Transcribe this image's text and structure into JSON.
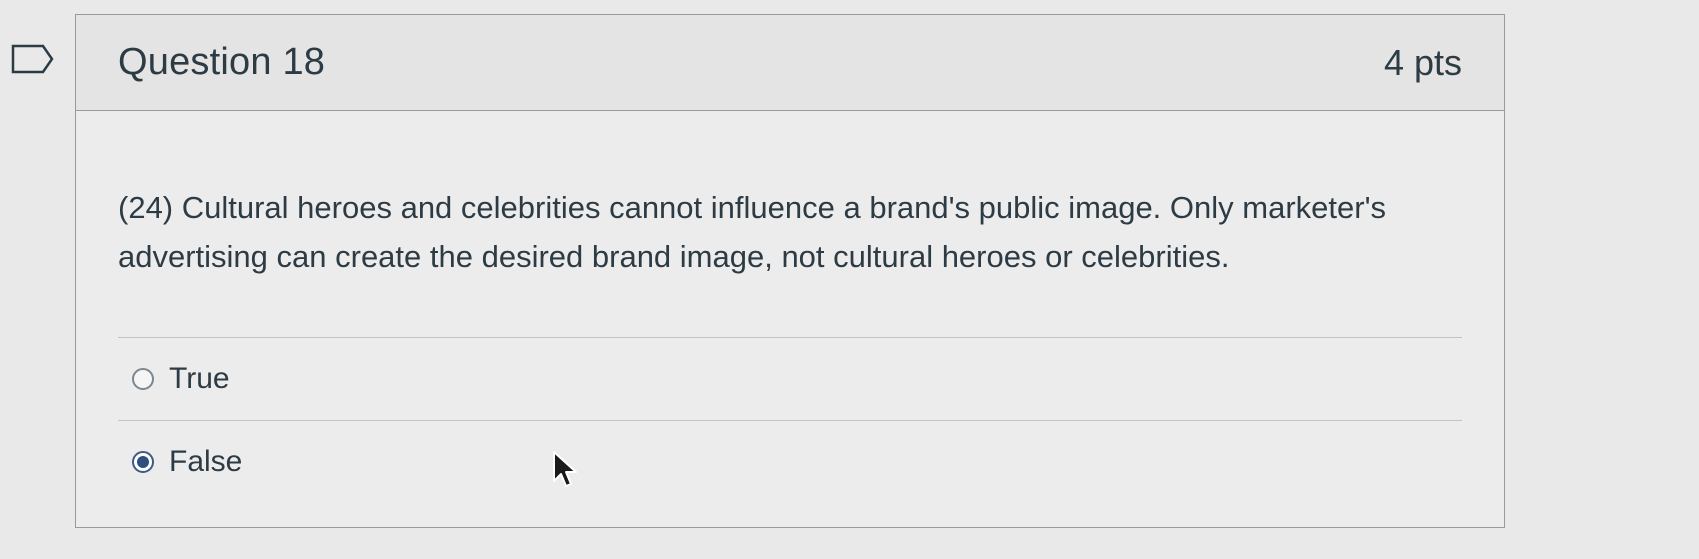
{
  "question": {
    "title": "Question 18",
    "points": "4 pts",
    "text": "(24) Cultural heroes and celebrities cannot influence a brand's public image. Only marketer's advertising can create the desired brand image, not cultural heroes or celebrities."
  },
  "answers": [
    {
      "label": "True",
      "selected": false
    },
    {
      "label": "False",
      "selected": true
    }
  ],
  "icons": {
    "flag": "flag-icon",
    "cursor": "mouse-pointer-icon",
    "radio_unselected": "radio-unchecked-icon",
    "radio_selected": "radio-checked-icon"
  },
  "colors": {
    "page_background": "#e9e9e9",
    "header_background": "#e4e4e4",
    "text": "#2d3b45",
    "radio_selected": "#2e4f80",
    "border": "#9a9a9a"
  }
}
